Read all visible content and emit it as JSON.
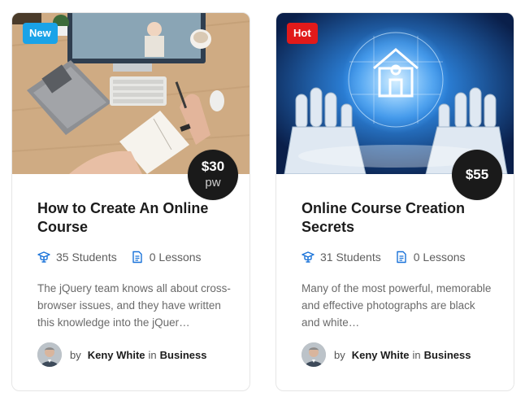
{
  "courses": [
    {
      "badge": "New",
      "badge_color": "#1aa3e8",
      "price": "$30",
      "price_period": "pw",
      "title": "How to Create An Online Course",
      "students": "35 Students",
      "lessons": "0 Lessons",
      "description": "The jQuery team knows all about cross-browser issues, and they have written this knowledge into the jQuer…",
      "by_label": "by",
      "author": "Keny White",
      "in_label": "in",
      "category": "Business",
      "thumb_icon": "desk-workspace-photo"
    },
    {
      "badge": "Hot",
      "badge_color": "#e11a1a",
      "price": "$55",
      "price_period": "",
      "title": "Online Course Creation Secrets",
      "students": "31 Students",
      "lessons": "0 Lessons",
      "description": "Many of the most powerful, memorable and effective photographs are black and white…",
      "by_label": "by",
      "author": "Keny White",
      "in_label": "in",
      "category": "Business",
      "thumb_icon": "robot-hands-smart-home-photo"
    }
  ],
  "colors": {
    "accent": "#1a73d9",
    "price_bg": "#1a1a1a"
  }
}
